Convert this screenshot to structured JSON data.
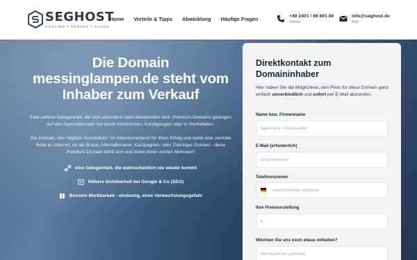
{
  "header": {
    "logo": {
      "name": "SEGHOST",
      "tagline": "HOSTING • SERVER • CLOUD"
    },
    "nav": [
      "Home",
      "Vorteile & Tipps",
      "Abwicklung",
      "Häufige Fragen"
    ],
    "phone": {
      "number": "+49 2401 / 86 801 80",
      "label": "Telefon"
    },
    "email": {
      "address": "info@seghost.de",
      "label": "Mail"
    }
  },
  "hero": {
    "title": "Die Domain messinglampen.de steht vom Inhaber zum Verkauf",
    "paragraph1": "Eine seltene Gelegenheit, die sich vermutlich nicht wiederholen wird. Premium-Domains gelangen auf den Sekundärmarkt nur durch Insolvenzen, Kündigungen oder in Sterbefällen.",
    "paragraph2": "Die Domain, das \"digitale Grundstück\" ist mitentscheidend für Ihren Erfolg und spielt eine zentrale Rolle im Internet, ob als Brand, Alternativname, Kampagnen- oder Zubringer-Domain - diese Premium-Domain lohnt sich und bietet einen echten Mehrwert!",
    "benefits": [
      {
        "icon": "arrows-icon",
        "text": "eine Gelegenheit, die wahrscheinlich nie wieder kommt"
      },
      {
        "icon": "seo-icon",
        "text": "Höhere Sichtbarkeit bei Google & Co (SEO)"
      },
      {
        "icon": "book-icon",
        "text": "Bessere Merkbarkeit - eindeutig, ohne Verwechslungsgefahr"
      }
    ]
  },
  "form": {
    "title": "Direktkontakt zum Domaininhaber",
    "intro_pre": "Hier haben Sie die Möglichkeit, den Preis für diese Domain ganz einfach ",
    "intro_bold1": "unverbindlich",
    "intro_mid": " und ",
    "intro_bold2": "sofort",
    "intro_post": " per E-Mail abzurufen.",
    "name_label": "Name bzw. Firmenname",
    "name_placeholder": "Name bzw. Firmenname*",
    "email_label": "E-Mail (erforderlich)",
    "email_placeholder": "Email Adresse*",
    "phone_label": "Telefonnummer",
    "phone_placeholder": "Telefonnummer (optional)",
    "price_label": "Ihre Preisvorstellung",
    "price_placeholder": "€",
    "message_label": "Möchten Sie uns noch etwas mitteilen?",
    "message_placeholder": "Ihre Nachricht (optional)"
  },
  "colors": {
    "brand": "#2e3a4b",
    "hero_start": "#5e7ea2",
    "hero_end": "#233a58",
    "card_bg": "#f3f4f6"
  }
}
